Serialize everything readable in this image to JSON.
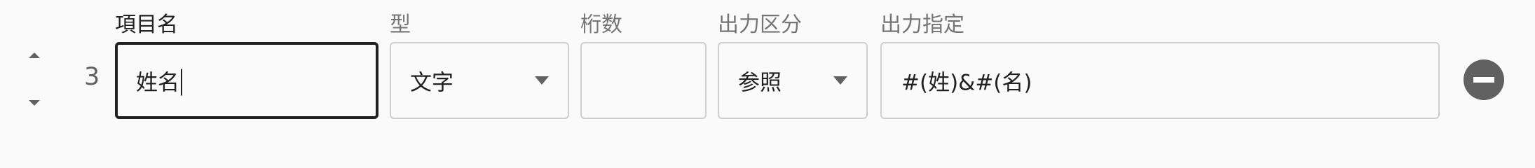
{
  "row": {
    "number": "3",
    "item_name": {
      "label": "項目名",
      "value": "姓名"
    },
    "type": {
      "label": "型",
      "value": "文字"
    },
    "digits": {
      "label": "桁数",
      "value": ""
    },
    "output_category": {
      "label": "出力区分",
      "value": "参照"
    },
    "output_spec": {
      "label": "出力指定",
      "value": "#(姓)&#(名)"
    }
  },
  "icons": {
    "move_up": "chevron-up-icon",
    "move_down": "chevron-down-icon",
    "remove": "remove-circle-icon",
    "dropdown": "arrow-drop-down-icon"
  },
  "colors": {
    "focused_border": "#212121",
    "border": "#cfcfcf",
    "label": "#757575",
    "icon": "#616161"
  }
}
